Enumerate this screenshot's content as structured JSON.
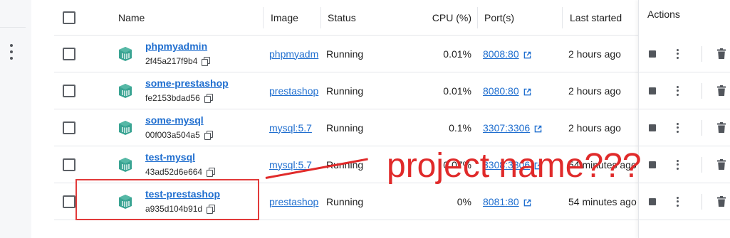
{
  "columns": {
    "name": "Name",
    "image": "Image",
    "status": "Status",
    "cpu": "CPU (%)",
    "ports": "Port(s)",
    "last_started": "Last started",
    "actions": "Actions"
  },
  "icons": {
    "container": "container-icon",
    "copy": "copy-icon",
    "external_link": "external-link-icon",
    "stop": "stop-icon",
    "more": "kebab-menu-icon",
    "delete": "trash-icon"
  },
  "colors": {
    "link": "#1f6ecf",
    "container_icon": "#3aa493",
    "annotation": "#e02a2a"
  },
  "rows": [
    {
      "name": "phpmyadmin",
      "id": "2f45a217f9b4",
      "image": "phpmyadm",
      "status": "Running",
      "cpu": "0.01%",
      "port": "8008:80",
      "last_started": "2 hours ago"
    },
    {
      "name": "some-prestashop",
      "id": "fe2153bdad56",
      "image": "prestashop",
      "status": "Running",
      "cpu": "0.01%",
      "port": "8080:80",
      "last_started": "2 hours ago"
    },
    {
      "name": "some-mysql",
      "id": "00f003a504a5",
      "image": "mysql:5.7",
      "status": "Running",
      "cpu": "0.1%",
      "port": "3307:3306",
      "last_started": "2 hours ago"
    },
    {
      "name": "test-mysql",
      "id": "43ad52d6e664",
      "image": "mysql:5.7",
      "status": "Running",
      "cpu": "0.07%",
      "port": "3308:3306",
      "last_started": "54 minutes ago"
    },
    {
      "name": "test-prestashop",
      "id": "a935d104b91d",
      "image": "prestashop",
      "status": "Running",
      "cpu": "0%",
      "port": "8081:80",
      "last_started": "54 minutes ago"
    }
  ],
  "annotation": {
    "text": "project name???"
  }
}
